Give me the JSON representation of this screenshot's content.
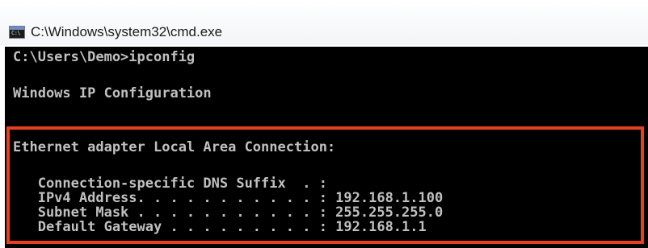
{
  "window": {
    "title": "C:\\Windows\\system32\\cmd.exe",
    "icon": "cmd-console-icon",
    "icon_text": "C:\\"
  },
  "console": {
    "lines": [
      "C:\\Users\\Demo>ipconfig",
      "Windows IP Configuration",
      "Ethernet adapter Local Area Connection:",
      "   Connection-specific DNS Suffix  . :",
      "   IPv4 Address. . . . . . . . . . . : 192.168.1.100",
      "   Subnet Mask . . . . . . . . . . . : 255.255.255.0",
      "   Default Gateway . . . . . . . . . : 192.168.1.1"
    ]
  },
  "colors": {
    "console_background": "#000000",
    "console_text": "#c0c0c0",
    "highlight_border": "#e8401e"
  }
}
